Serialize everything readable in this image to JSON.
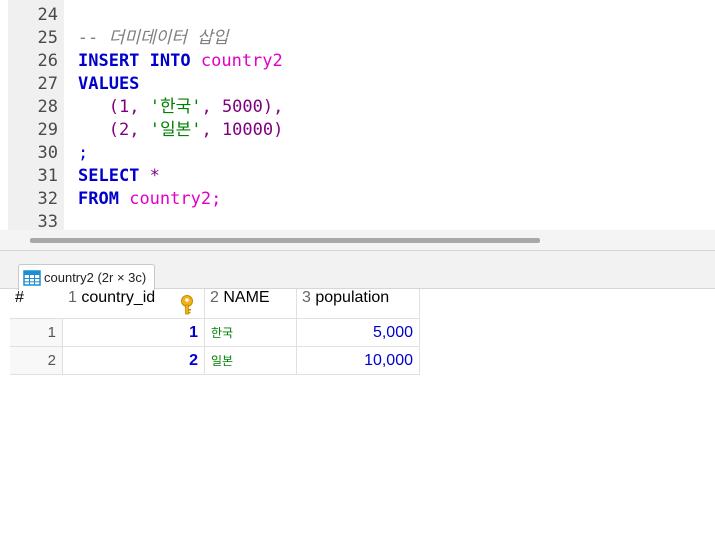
{
  "editor": {
    "lines": [
      {
        "n": "24"
      },
      {
        "n": "25",
        "comment": "-- 더미데이터 삽입"
      },
      {
        "n": "26",
        "kw1": "INSERT",
        "kw2": "INTO",
        "ident": "country2"
      },
      {
        "n": "27",
        "kw1": "VALUES"
      },
      {
        "n": "28",
        "num1": "1",
        "str": "'한국'",
        "num2": "5000"
      },
      {
        "n": "29",
        "num1": "2",
        "str": "'일본'",
        "num2": "10000"
      },
      {
        "n": "30",
        "punct": ";"
      },
      {
        "n": "31",
        "kw1": "SELECT",
        "star": "*"
      },
      {
        "n": "32",
        "kw1": "FROM",
        "ident": "country2;"
      },
      {
        "n": "33"
      }
    ]
  },
  "results": {
    "tab_label": "country2 (2r × 3c)",
    "columns": [
      {
        "num": "#",
        "name": ""
      },
      {
        "num": "1",
        "name": "country_id"
      },
      {
        "num": "2",
        "name": "NAME"
      },
      {
        "num": "3",
        "name": "population"
      }
    ],
    "rows": [
      {
        "rownum": "1",
        "country_id": "1",
        "name": "한국",
        "population": "5,000"
      },
      {
        "rownum": "2",
        "country_id": "2",
        "name": "일본",
        "population": "10,000"
      }
    ]
  },
  "icons": {
    "tab": "table-icon",
    "key": "primary-key-icon"
  },
  "colors": {
    "keyword": "#0000cc",
    "identifier": "#e000c8",
    "string": "#008000",
    "number": "#7f007f",
    "comment": "#7f7f7f"
  }
}
